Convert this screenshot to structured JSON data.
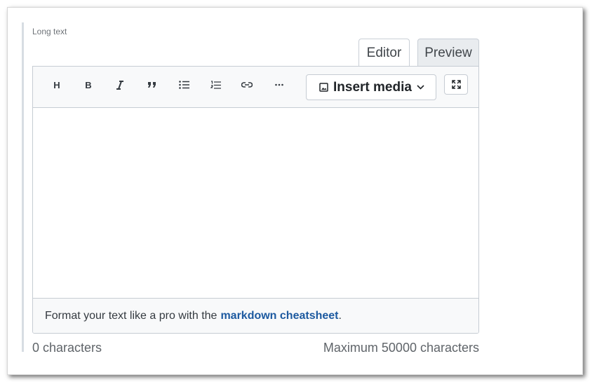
{
  "field": {
    "label": "Long text"
  },
  "tabs": [
    {
      "label": "Editor",
      "active": true
    },
    {
      "label": "Preview",
      "active": false
    }
  ],
  "toolbar": {
    "heading_label": "H",
    "bold_label": "B",
    "insert_media_label": "Insert media",
    "icons": [
      "heading-icon",
      "bold-icon",
      "italic-icon",
      "quote-icon",
      "bullet-list-icon",
      "numbered-list-icon",
      "link-icon",
      "more-icon",
      "image-icon",
      "chevron-down-icon",
      "fullscreen-icon"
    ]
  },
  "editor": {
    "value": ""
  },
  "footer": {
    "text": "Format your text like a pro with the",
    "link_text": "markdown cheatsheet",
    "trailing": "."
  },
  "counter": {
    "current": "0 characters",
    "maximum": "Maximum 50000 characters"
  },
  "colors": {
    "link": "#1d5aa0",
    "toolbar_bg": "#f8f9fa",
    "border": "#c6ccd3",
    "inactive_tab_bg": "#e9ecef"
  }
}
